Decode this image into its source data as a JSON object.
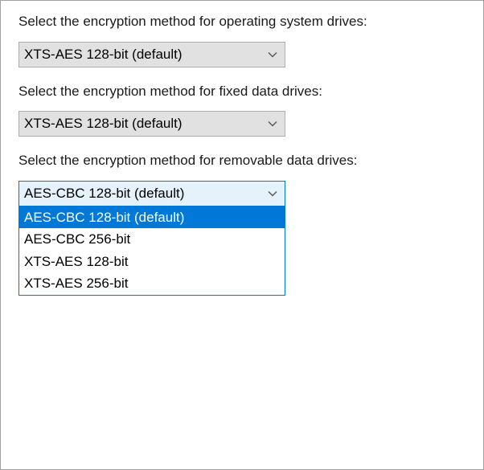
{
  "os_drives": {
    "label": "Select the encryption method for operating system drives:",
    "selected": "XTS-AES 128-bit (default)"
  },
  "fixed_drives": {
    "label": "Select the encryption method for fixed data drives:",
    "selected": "XTS-AES 128-bit (default)"
  },
  "removable_drives": {
    "label": "Select the encryption method for removable data drives:",
    "selected": "AES-CBC 128-bit  (default)",
    "options": [
      "AES-CBC 128-bit  (default)",
      "AES-CBC 256-bit",
      "XTS-AES 128-bit",
      "XTS-AES 256-bit"
    ],
    "highlighted_index": 0
  }
}
